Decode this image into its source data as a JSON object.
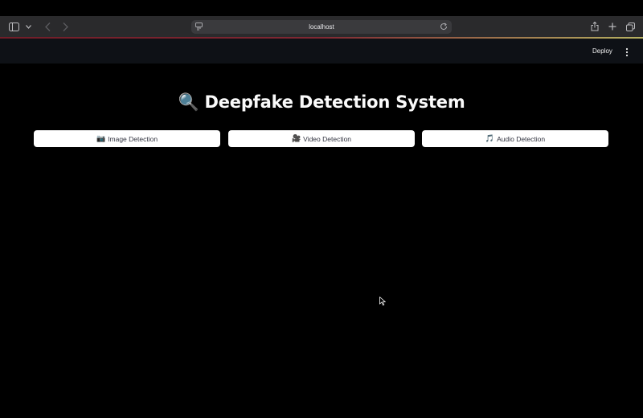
{
  "browser": {
    "url": "localhost"
  },
  "header": {
    "deploy_label": "Deploy"
  },
  "main": {
    "title_icon": "🔍",
    "title": "Deepfake Detection System",
    "buttons": [
      {
        "icon": "📷",
        "label": "Image Detection"
      },
      {
        "icon": "🎥",
        "label": "Video Detection"
      },
      {
        "icon": "🎵",
        "label": "Audio Detection"
      }
    ]
  },
  "colors": {
    "background": "#000000",
    "header_bg": "#0e1116",
    "button_bg": "#ffffff",
    "button_text": "#31333f",
    "title": "#fafafa"
  }
}
